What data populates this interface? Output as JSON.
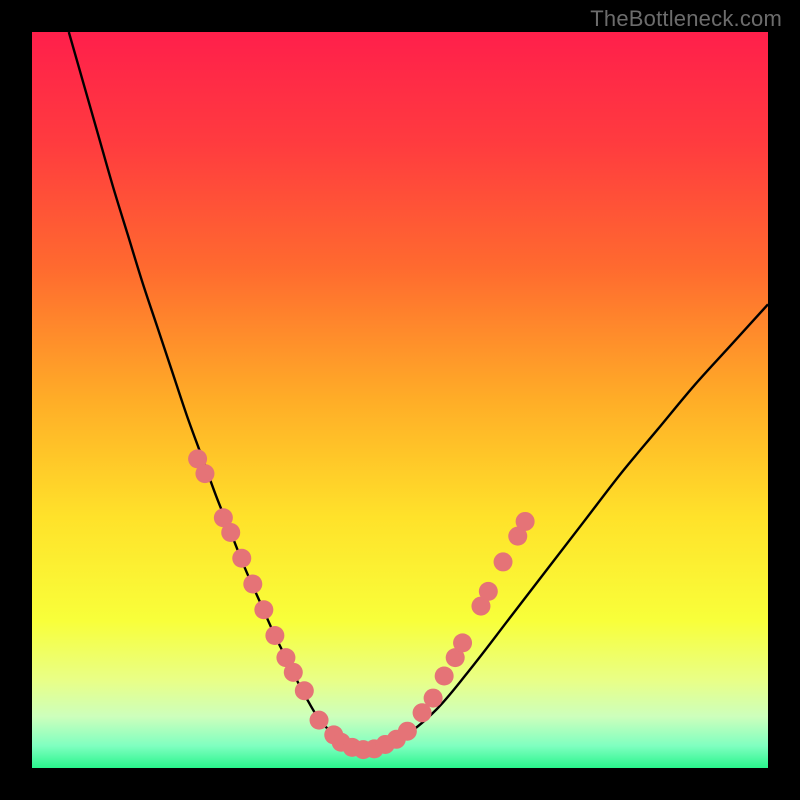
{
  "watermark": "TheBottleneck.com",
  "chart_data": {
    "type": "line",
    "title": "",
    "xlabel": "",
    "ylabel": "",
    "xlim": [
      0,
      100
    ],
    "ylim": [
      0,
      100
    ],
    "grid": false,
    "legend": false,
    "background_gradient_stops": [
      {
        "offset": 0.0,
        "color": "#ff1f4b"
      },
      {
        "offset": 0.15,
        "color": "#ff3b3f"
      },
      {
        "offset": 0.32,
        "color": "#ff6a2f"
      },
      {
        "offset": 0.5,
        "color": "#ffad27"
      },
      {
        "offset": 0.66,
        "color": "#ffe22a"
      },
      {
        "offset": 0.8,
        "color": "#f8ff3a"
      },
      {
        "offset": 0.88,
        "color": "#e9ff86"
      },
      {
        "offset": 0.93,
        "color": "#cdffbc"
      },
      {
        "offset": 0.97,
        "color": "#7fffc0"
      },
      {
        "offset": 1.0,
        "color": "#29f58c"
      }
    ],
    "series": [
      {
        "name": "bottleneck-curve",
        "x": [
          5,
          7,
          9,
          11,
          13,
          15,
          17,
          19,
          21,
          23,
          25,
          27,
          29,
          31,
          33,
          35,
          37,
          40,
          45,
          50,
          55,
          60,
          65,
          70,
          75,
          80,
          85,
          90,
          95,
          100
        ],
        "y": [
          100,
          93,
          86,
          79,
          72.5,
          66,
          60,
          54,
          48,
          42.5,
          37,
          32,
          27,
          22.5,
          18,
          14,
          10,
          5.5,
          2.5,
          4,
          8,
          14,
          20.5,
          27,
          33.5,
          40,
          46,
          52,
          57.5,
          63
        ],
        "color": "#000000"
      }
    ],
    "marker_clusters": [
      {
        "name": "left-upper-dots",
        "color": "#e57377",
        "points": [
          {
            "x": 22.5,
            "y": 42
          },
          {
            "x": 23.5,
            "y": 40
          },
          {
            "x": 26.0,
            "y": 34
          },
          {
            "x": 27.0,
            "y": 32
          },
          {
            "x": 28.5,
            "y": 28.5
          },
          {
            "x": 30.0,
            "y": 25
          }
        ]
      },
      {
        "name": "left-lower-dots",
        "color": "#e57377",
        "points": [
          {
            "x": 31.5,
            "y": 21.5
          },
          {
            "x": 33.0,
            "y": 18
          },
          {
            "x": 34.5,
            "y": 15
          },
          {
            "x": 35.5,
            "y": 13
          },
          {
            "x": 37.0,
            "y": 10.5
          }
        ]
      },
      {
        "name": "bottom-dots",
        "color": "#e57377",
        "points": [
          {
            "x": 39.0,
            "y": 6.5
          },
          {
            "x": 41.0,
            "y": 4.5
          },
          {
            "x": 42.0,
            "y": 3.5
          },
          {
            "x": 43.5,
            "y": 2.8
          },
          {
            "x": 45.0,
            "y": 2.5
          },
          {
            "x": 46.5,
            "y": 2.6
          },
          {
            "x": 48.0,
            "y": 3.2
          },
          {
            "x": 49.5,
            "y": 3.9
          },
          {
            "x": 51.0,
            "y": 5.0
          }
        ]
      },
      {
        "name": "right-dots",
        "color": "#e57377",
        "points": [
          {
            "x": 53.0,
            "y": 7.5
          },
          {
            "x": 54.5,
            "y": 9.5
          },
          {
            "x": 56.0,
            "y": 12.5
          },
          {
            "x": 57.5,
            "y": 15
          },
          {
            "x": 58.5,
            "y": 17
          },
          {
            "x": 61.0,
            "y": 22
          },
          {
            "x": 62.0,
            "y": 24
          },
          {
            "x": 64.0,
            "y": 28
          },
          {
            "x": 66.0,
            "y": 31.5
          },
          {
            "x": 67.0,
            "y": 33.5
          }
        ]
      }
    ]
  }
}
